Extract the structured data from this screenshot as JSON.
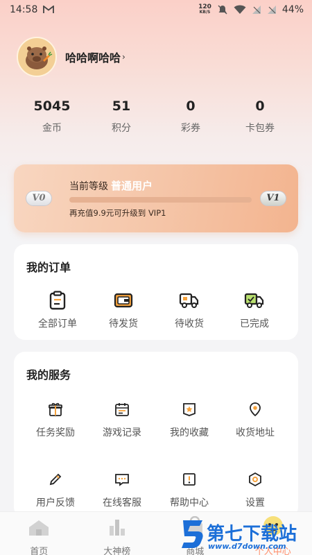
{
  "status_bar": {
    "time": "14:58",
    "net_speed_value": "120",
    "net_speed_unit": "KB/S",
    "battery": "44%"
  },
  "profile": {
    "username": "哈哈啊哈哈",
    "arrow": "›"
  },
  "stats": [
    {
      "value": "5045",
      "label": "金币"
    },
    {
      "value": "51",
      "label": "积分"
    },
    {
      "value": "0",
      "label": "彩券"
    },
    {
      "value": "0",
      "label": "卡包券"
    }
  ],
  "vip": {
    "current_label": "当前等级",
    "level_name": "普通用户",
    "current_badge": "V0",
    "next_badge": "V1",
    "progress": 0,
    "hint": "再充值9.9元可升级到 VIP1",
    "colors": {
      "card_start": "#f8d6c0",
      "card_end": "#f3b48f"
    }
  },
  "orders": {
    "title": "我的订单",
    "items": [
      {
        "label": "全部订单",
        "icon": "clipboard-icon"
      },
      {
        "label": "待发货",
        "icon": "wallet-icon"
      },
      {
        "label": "待收货",
        "icon": "truck-icon"
      },
      {
        "label": "已完成",
        "icon": "truck-done-icon"
      }
    ]
  },
  "services": {
    "title": "我的服务",
    "items": [
      {
        "label": "任务奖励",
        "icon": "gift-icon"
      },
      {
        "label": "游戏记录",
        "icon": "calendar-icon"
      },
      {
        "label": "我的收藏",
        "icon": "star-box-icon"
      },
      {
        "label": "收货地址",
        "icon": "location-icon"
      },
      {
        "label": "用户反馈",
        "icon": "pencil-icon"
      },
      {
        "label": "在线客服",
        "icon": "chat-icon"
      },
      {
        "label": "帮助中心",
        "icon": "help-icon"
      },
      {
        "label": "设置",
        "icon": "settings-icon"
      }
    ]
  },
  "bottom_nav": [
    {
      "label": "首页",
      "icon": "home-icon"
    },
    {
      "label": "大神榜",
      "icon": "ranking-icon"
    },
    {
      "label": "商城",
      "icon": "shop-icon"
    },
    {
      "label": "个人中心",
      "icon": "profile-icon"
    }
  ],
  "watermark": {
    "text": "第七下载站",
    "url": "www.d7down.com"
  },
  "colors": {
    "accent": "#ff8f6b",
    "icon_orange": "#f5a23c",
    "text_dark": "#222222"
  }
}
